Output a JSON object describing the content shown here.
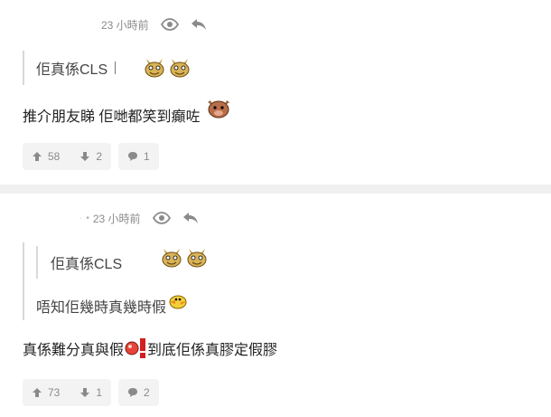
{
  "post1": {
    "meta": {
      "time": "23 小時前"
    },
    "quote": {
      "text": "佢真係CLS"
    },
    "body": {
      "text": "推介朋友睇 佢哋都笑到癲咗"
    },
    "actions": {
      "upvotes": "58",
      "downvotes": "2",
      "replies": "1"
    }
  },
  "post2": {
    "meta": {
      "time": "23 小時前"
    },
    "quote": {
      "nested_text": "佢真係CLS",
      "text": "唔知佢幾時真幾時假"
    },
    "body": {
      "text_before": "真係難分真與假",
      "text_after": "到底佢係真膠定假膠"
    },
    "actions": {
      "upvotes": "73",
      "downvotes": "1",
      "replies": "2"
    }
  },
  "icons": {
    "view": "eye-icon",
    "reply": "reply-arrow-icon",
    "up": "arrow-up-icon",
    "down": "arrow-down-icon",
    "comment": "speech-bubble-icon",
    "stickers": [
      "bird-sticker",
      "bull-face-sticker",
      "duck-sticker",
      "red-ball-sticker",
      "exclaim-sticker"
    ]
  },
  "colors": {
    "meta": "#8a8a8a",
    "button_bg": "#f3f3f3",
    "divider": "#f0f0f0"
  }
}
